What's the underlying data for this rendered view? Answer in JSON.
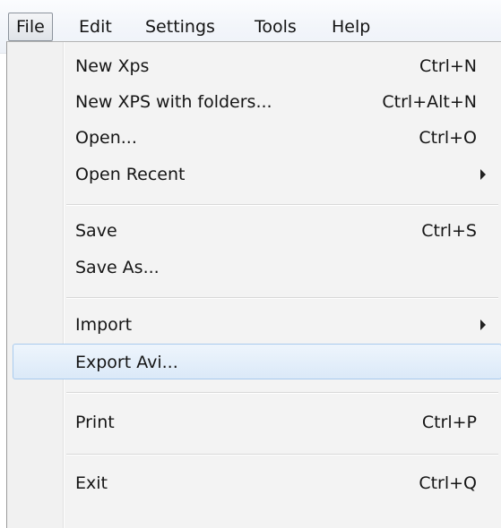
{
  "menubar": {
    "items": [
      {
        "label": "File",
        "active": true
      },
      {
        "label": "Edit",
        "active": false
      },
      {
        "label": "Settings",
        "active": false
      },
      {
        "label": "Tools",
        "active": false
      },
      {
        "label": "Help",
        "active": false
      }
    ]
  },
  "file_menu": {
    "items": [
      {
        "label": "New Xps",
        "shortcut": "Ctrl+N"
      },
      {
        "label": "New XPS with folders...",
        "shortcut": "Ctrl+Alt+N"
      },
      {
        "label": "Open...",
        "shortcut": "Ctrl+O"
      },
      {
        "label": "Open Recent",
        "submenu": true
      },
      {
        "label": "Save",
        "shortcut": "Ctrl+S"
      },
      {
        "label": "Save As..."
      },
      {
        "label": "Import",
        "submenu": true
      },
      {
        "label": "Export Avi...",
        "highlighted": true
      },
      {
        "label": "Print",
        "shortcut": "Ctrl+P"
      },
      {
        "label": "Exit",
        "shortcut": "Ctrl+Q"
      }
    ]
  },
  "colors": {
    "menubar_background": "#f2f5fa",
    "menu_background": "#f3f3f3",
    "highlight_background": "#dbe9f8",
    "highlight_border": "#a9cbee",
    "text": "#151515"
  },
  "icons": {
    "submenu_arrow": "chevron-right-icon"
  }
}
